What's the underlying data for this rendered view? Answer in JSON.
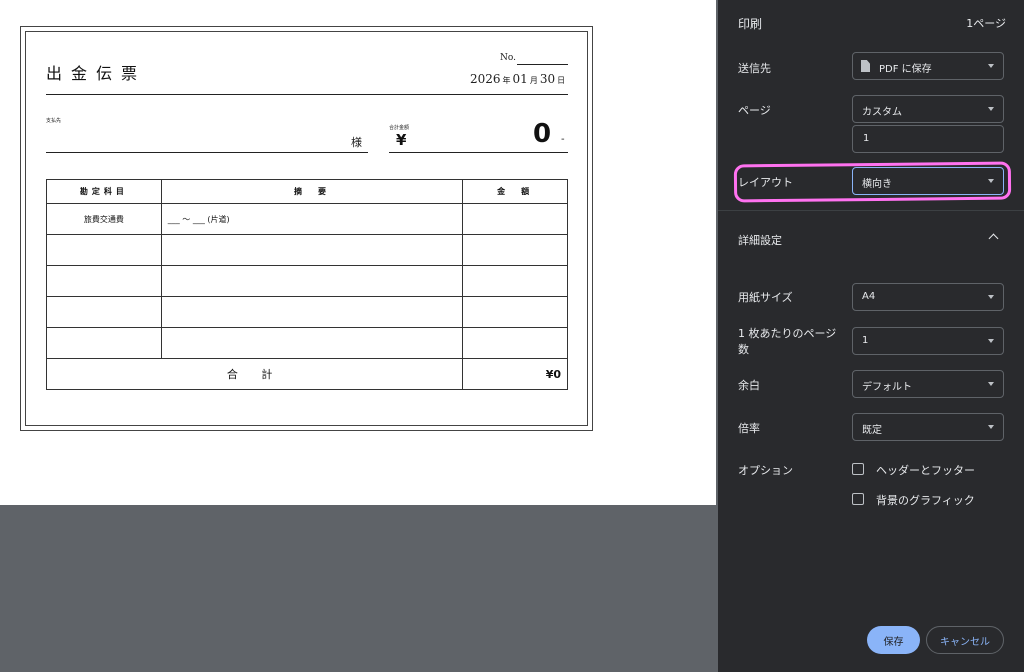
{
  "preview": {
    "slip": {
      "title": "出金伝票",
      "no_label": "No.",
      "date": {
        "year": "2026",
        "year_unit": "年",
        "month": "01",
        "month_unit": "月",
        "day": "30",
        "day_unit": "日"
      },
      "payee_label": "支払先",
      "payee_suffix": "様",
      "total_label": "合計金額",
      "total_currency": "¥",
      "total_amount": "0",
      "total_dash": "-",
      "table": {
        "headers": [
          "勘定科目",
          "摘　要",
          "金　額"
        ],
        "rows": [
          {
            "account": "旅費交通費",
            "summary": "___ 〜 ___ (片道)",
            "amount": ""
          },
          {
            "account": "",
            "summary": "",
            "amount": ""
          },
          {
            "account": "",
            "summary": "",
            "amount": ""
          },
          {
            "account": "",
            "summary": "",
            "amount": ""
          },
          {
            "account": "",
            "summary": "",
            "amount": ""
          }
        ],
        "sum_label": "合 計",
        "sum_value": "¥0"
      }
    }
  },
  "panel": {
    "title": "印刷",
    "page_count": "1ページ",
    "destination": {
      "label": "送信先",
      "value": "PDF に保存"
    },
    "pages": {
      "label": "ページ",
      "value": "カスタム",
      "range_value": "1"
    },
    "layout": {
      "label": "レイアウト",
      "value": "横向き"
    },
    "more_settings": {
      "label": "詳細設定"
    },
    "paper_size": {
      "label": "用紙サイズ",
      "value": "A4"
    },
    "pages_per_sheet": {
      "label": "1 枚あたりのページ数",
      "value": "1"
    },
    "margins": {
      "label": "余白",
      "value": "デフォルト"
    },
    "scale": {
      "label": "倍率",
      "value": "既定"
    },
    "options": {
      "label": "オプション",
      "headers_footers": {
        "label": "ヘッダーとフッター",
        "checked": false
      },
      "background_graphics": {
        "label": "背景のグラフィック",
        "checked": false
      }
    },
    "save_label": "保存",
    "cancel_label": "キャンセル"
  },
  "colors": {
    "panel_bg": "#292a2d",
    "accent": "#8ab4f8",
    "highlight": "#ff72f0"
  }
}
